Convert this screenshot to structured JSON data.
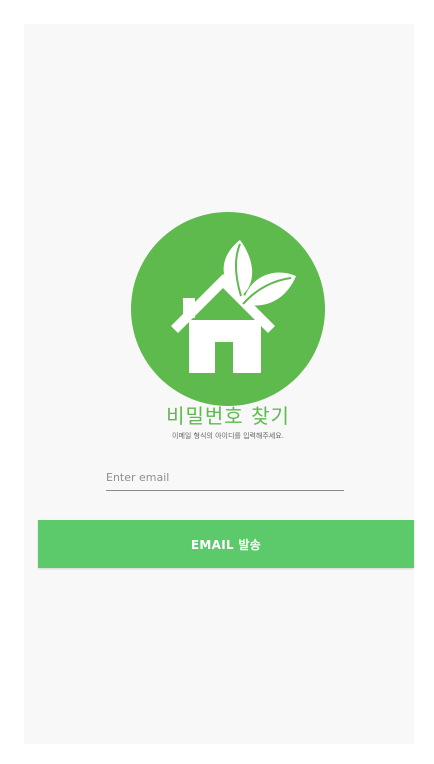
{
  "colors": {
    "brand": "#5fba4e",
    "button": "#5cc96a",
    "title": "#5cbb4c",
    "background": "#f8f8f8"
  },
  "logo": {
    "icon": "home-leaf-icon"
  },
  "header": {
    "title": "비밀번호 찾기",
    "subtitle": "이메일 형식의 아이디를 입력해주세요."
  },
  "form": {
    "email_value": "",
    "email_placeholder": "Enter email",
    "send_label": "EMAIL 발송"
  }
}
